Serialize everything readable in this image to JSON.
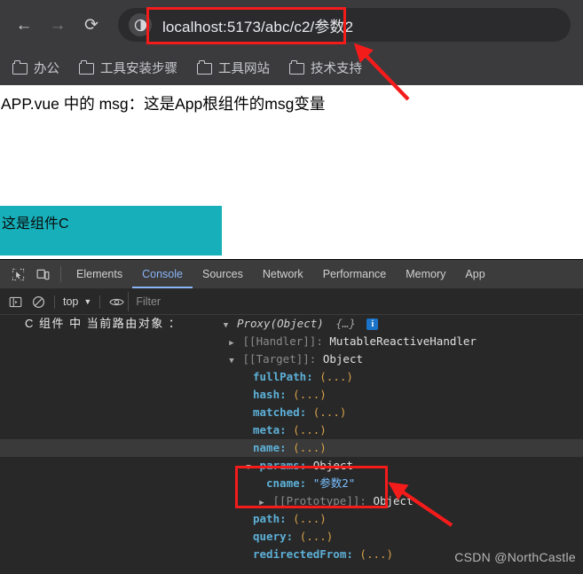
{
  "browser": {
    "nav": {
      "back_icon": "←",
      "forward_icon": "→",
      "reload_icon": "⟳"
    },
    "omnibox": {
      "url": "localhost:5173/abc/c2/参数2",
      "site_info_icon": "info-circle-icon"
    },
    "bookmarks": [
      {
        "label": "办公",
        "icon": "folder-icon"
      },
      {
        "label": "工具安装步骤",
        "icon": "folder-icon"
      },
      {
        "label": "工具网站",
        "icon": "folder-icon"
      },
      {
        "label": "技术支持",
        "icon": "folder-icon"
      }
    ]
  },
  "page": {
    "app_msg": "APP.vue 中的 msg：这是App根组件的msg变量",
    "component_c_label": "这是组件C",
    "component_c_color": "#17b0ba"
  },
  "devtools": {
    "tabs": [
      {
        "label": "Elements",
        "active": false
      },
      {
        "label": "Console",
        "active": true
      },
      {
        "label": "Sources",
        "active": false
      },
      {
        "label": "Network",
        "active": false
      },
      {
        "label": "Performance",
        "active": false
      },
      {
        "label": "Memory",
        "active": false
      },
      {
        "label": "App",
        "active": false
      }
    ],
    "toolbar_icons": [
      "inspect-element-icon",
      "device-toolbar-icon"
    ],
    "filterbar": {
      "sidebar_toggle_icon": "sidebar-toggle-icon",
      "clear_console_icon": "clear-console-icon",
      "context_selector": "top",
      "context_caret": "▼",
      "eye_icon": "eye-icon",
      "filter_placeholder": "Filter"
    },
    "accent_color": "#8ab4f8",
    "console": {
      "log_label": "C 组件 中 当前路由对象 ：",
      "root": {
        "arrow": "▼",
        "type": "Proxy(Object)",
        "preview": "{…}",
        "info_badge": "i"
      },
      "rows": [
        {
          "indent": 1,
          "arrow": "▶",
          "key": "[[Handler]]",
          "kind": "internal",
          "value": "MutableReactiveHandler",
          "highlight": false
        },
        {
          "indent": 1,
          "arrow": "▼",
          "key": "[[Target]]",
          "kind": "internal",
          "value": "Object",
          "highlight": false
        },
        {
          "indent": 2,
          "arrow": "",
          "key": "fullPath",
          "kind": "prop",
          "value": "(...)",
          "highlight": false
        },
        {
          "indent": 2,
          "arrow": "",
          "key": "hash",
          "kind": "prop",
          "value": "(...)",
          "highlight": false
        },
        {
          "indent": 2,
          "arrow": "",
          "key": "matched",
          "kind": "prop",
          "value": "(...)",
          "highlight": false
        },
        {
          "indent": 2,
          "arrow": "",
          "key": "meta",
          "kind": "prop",
          "value": "(...)",
          "highlight": false
        },
        {
          "indent": 2,
          "arrow": "",
          "key": "name",
          "kind": "prop",
          "value": "(...)",
          "highlight": true
        },
        {
          "indent": 2,
          "arrow": "▼",
          "key": "params",
          "kind": "prop-obj",
          "value": "Object",
          "highlight": false
        },
        {
          "indent": 3,
          "arrow": "",
          "key": "cname",
          "kind": "prop-str",
          "value": "\"参数2\"",
          "highlight": false
        },
        {
          "indent": 3,
          "arrow": "▶",
          "key": "[[Prototype]]",
          "kind": "internal",
          "value": "Object",
          "highlight": false
        },
        {
          "indent": 2,
          "arrow": "",
          "key": "path",
          "kind": "prop",
          "value": "(...)",
          "highlight": false
        },
        {
          "indent": 2,
          "arrow": "",
          "key": "query",
          "kind": "prop",
          "value": "(...)",
          "highlight": false
        },
        {
          "indent": 2,
          "arrow": "",
          "key": "redirectedFrom",
          "kind": "prop",
          "value": "(...)",
          "highlight": false
        }
      ]
    },
    "watermark": "CSDN @NorthCastle"
  },
  "annotations": {
    "highlight_color": "#f41b1b",
    "boxes": [
      "url-highlight",
      "params-highlight"
    ],
    "arrows": [
      "arrow-to-url",
      "arrow-to-params"
    ]
  }
}
